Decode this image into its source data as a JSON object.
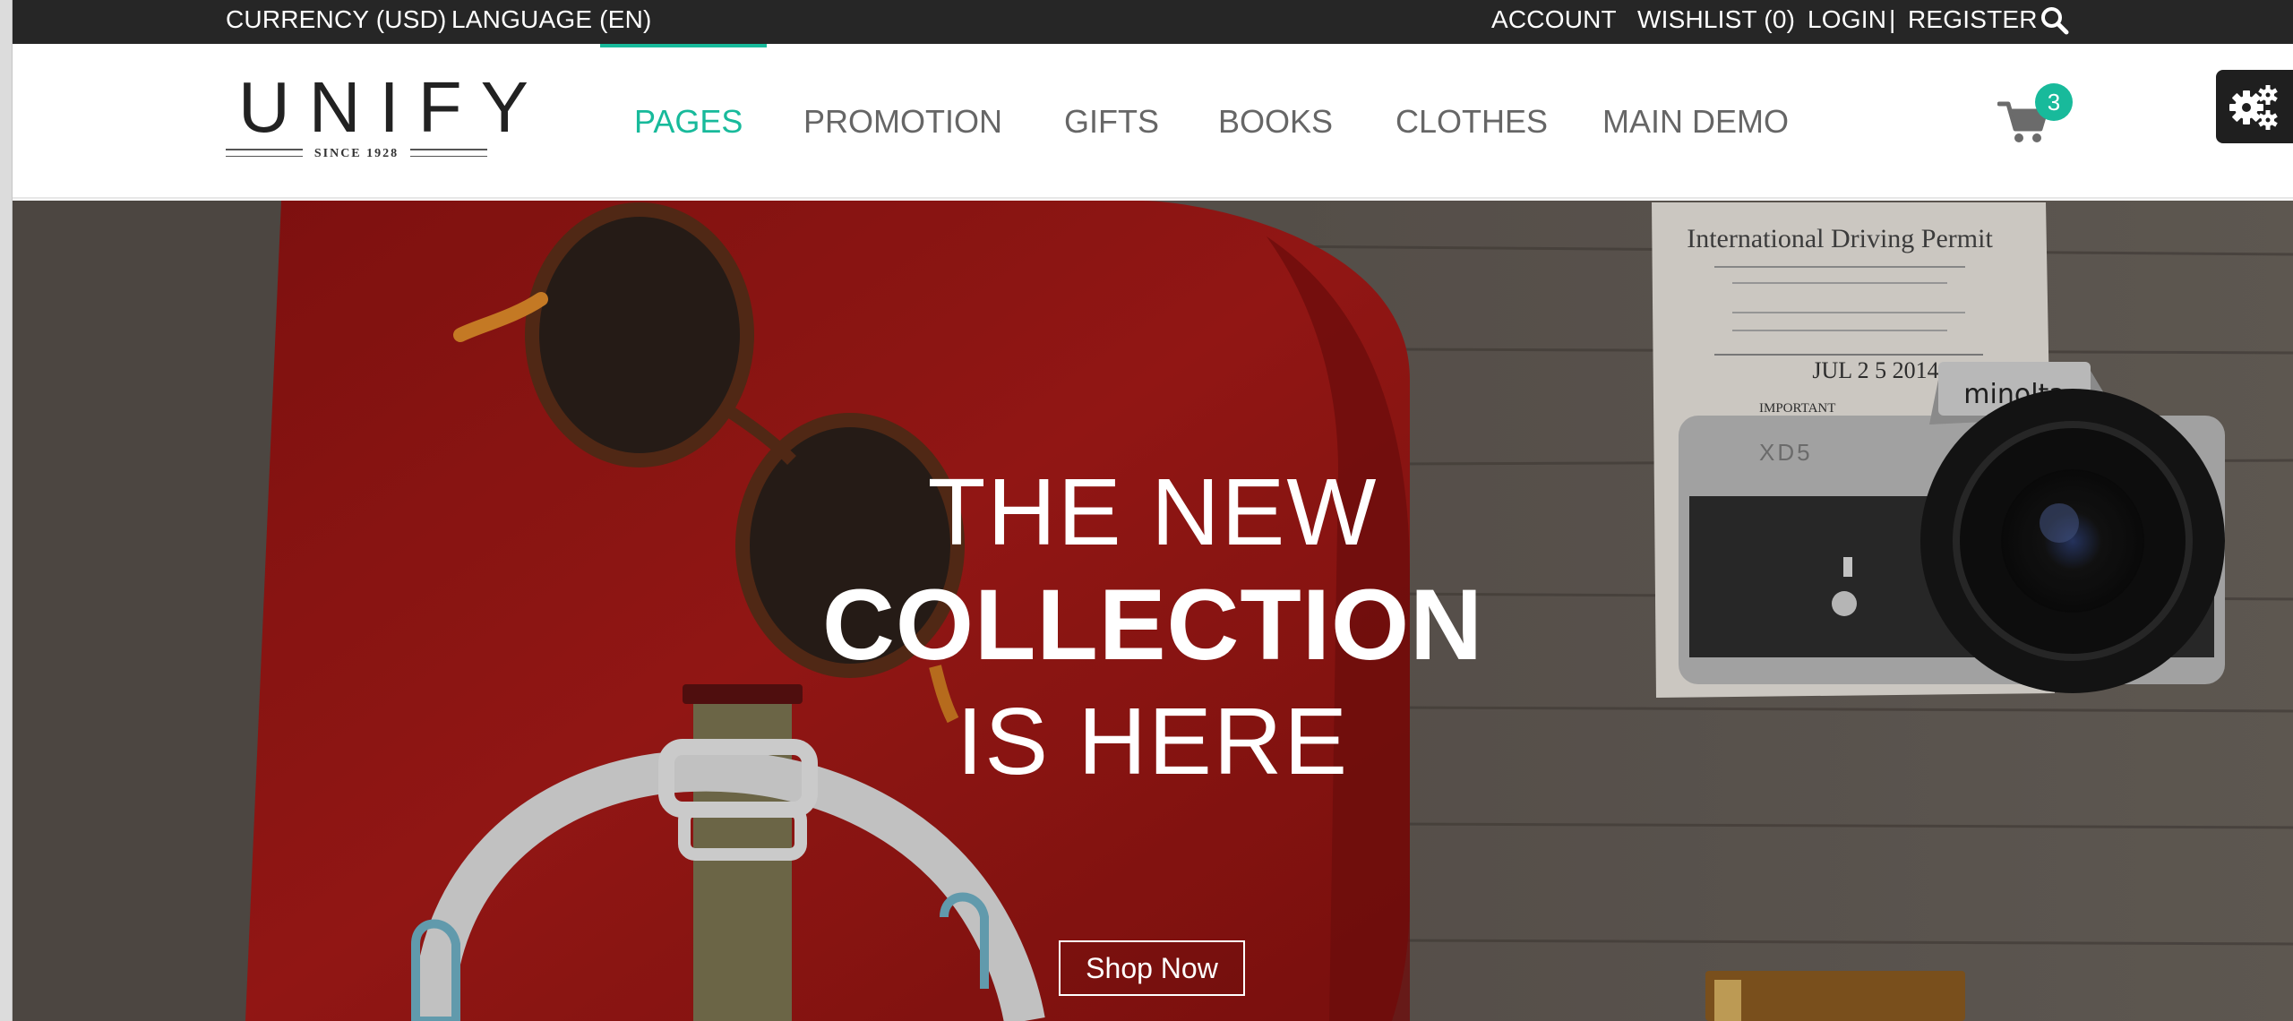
{
  "topbar": {
    "currency": "CURRENCY (USD)",
    "language": "LANGUAGE (EN)",
    "account": "ACCOUNT",
    "wishlist": "WISHLIST (0)",
    "login": "LOGIN",
    "separator": "|",
    "register": "REGISTER",
    "search_icon": "search-icon"
  },
  "logo": {
    "name": "UNIFY",
    "since": "SINCE 1928"
  },
  "nav": {
    "items": [
      {
        "label": "PAGES",
        "active": true
      },
      {
        "label": "PROMOTION",
        "active": false
      },
      {
        "label": "GIFTS",
        "active": false
      },
      {
        "label": "BOOKS",
        "active": false
      },
      {
        "label": "CLOTHES",
        "active": false
      },
      {
        "label": "MAIN DEMO",
        "active": false
      }
    ]
  },
  "cart": {
    "icon": "cart-icon",
    "count": "3"
  },
  "settings": {
    "icon": "gears-icon"
  },
  "hero": {
    "line1": "THE NEW",
    "line2": "COLLECTION",
    "line3": "IS HERE",
    "button": "Shop Now",
    "permit_title": "International Driving Permit",
    "permit_date": "JUL 2 5 2014",
    "permit_important": "IMPORTANT",
    "camera_brand": "minolta",
    "camera_model": "XD5"
  },
  "colors": {
    "accent": "#18ba9b",
    "topbar_bg": "#262626",
    "nav_text": "#666666"
  }
}
